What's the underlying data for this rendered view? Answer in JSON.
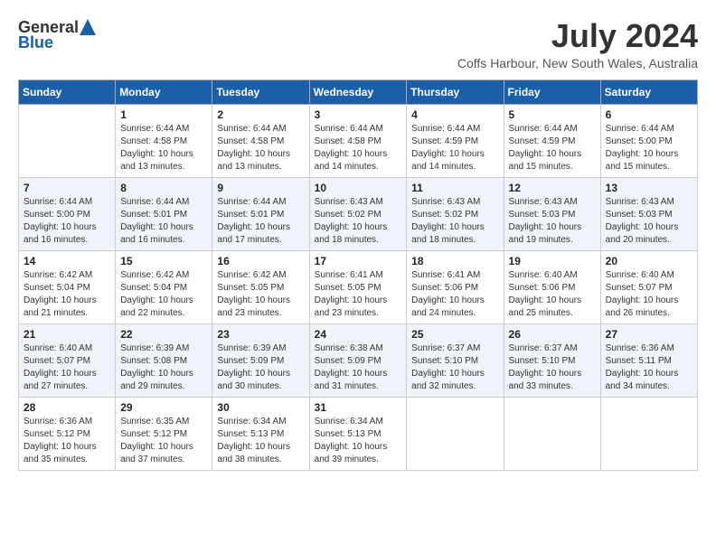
{
  "header": {
    "logo_general": "General",
    "logo_blue": "Blue",
    "month_year": "July 2024",
    "location": "Coffs Harbour, New South Wales, Australia"
  },
  "days_of_week": [
    "Sunday",
    "Monday",
    "Tuesday",
    "Wednesday",
    "Thursday",
    "Friday",
    "Saturday"
  ],
  "weeks": [
    [
      {
        "day": "",
        "sunrise": "",
        "sunset": "",
        "daylight": ""
      },
      {
        "day": "1",
        "sunrise": "Sunrise: 6:44 AM",
        "sunset": "Sunset: 4:58 PM",
        "daylight": "Daylight: 10 hours and 13 minutes."
      },
      {
        "day": "2",
        "sunrise": "Sunrise: 6:44 AM",
        "sunset": "Sunset: 4:58 PM",
        "daylight": "Daylight: 10 hours and 13 minutes."
      },
      {
        "day": "3",
        "sunrise": "Sunrise: 6:44 AM",
        "sunset": "Sunset: 4:58 PM",
        "daylight": "Daylight: 10 hours and 14 minutes."
      },
      {
        "day": "4",
        "sunrise": "Sunrise: 6:44 AM",
        "sunset": "Sunset: 4:59 PM",
        "daylight": "Daylight: 10 hours and 14 minutes."
      },
      {
        "day": "5",
        "sunrise": "Sunrise: 6:44 AM",
        "sunset": "Sunset: 4:59 PM",
        "daylight": "Daylight: 10 hours and 15 minutes."
      },
      {
        "day": "6",
        "sunrise": "Sunrise: 6:44 AM",
        "sunset": "Sunset: 5:00 PM",
        "daylight": "Daylight: 10 hours and 15 minutes."
      }
    ],
    [
      {
        "day": "7",
        "sunrise": "Sunrise: 6:44 AM",
        "sunset": "Sunset: 5:00 PM",
        "daylight": "Daylight: 10 hours and 16 minutes."
      },
      {
        "day": "8",
        "sunrise": "Sunrise: 6:44 AM",
        "sunset": "Sunset: 5:01 PM",
        "daylight": "Daylight: 10 hours and 16 minutes."
      },
      {
        "day": "9",
        "sunrise": "Sunrise: 6:44 AM",
        "sunset": "Sunset: 5:01 PM",
        "daylight": "Daylight: 10 hours and 17 minutes."
      },
      {
        "day": "10",
        "sunrise": "Sunrise: 6:43 AM",
        "sunset": "Sunset: 5:02 PM",
        "daylight": "Daylight: 10 hours and 18 minutes."
      },
      {
        "day": "11",
        "sunrise": "Sunrise: 6:43 AM",
        "sunset": "Sunset: 5:02 PM",
        "daylight": "Daylight: 10 hours and 18 minutes."
      },
      {
        "day": "12",
        "sunrise": "Sunrise: 6:43 AM",
        "sunset": "Sunset: 5:03 PM",
        "daylight": "Daylight: 10 hours and 19 minutes."
      },
      {
        "day": "13",
        "sunrise": "Sunrise: 6:43 AM",
        "sunset": "Sunset: 5:03 PM",
        "daylight": "Daylight: 10 hours and 20 minutes."
      }
    ],
    [
      {
        "day": "14",
        "sunrise": "Sunrise: 6:42 AM",
        "sunset": "Sunset: 5:04 PM",
        "daylight": "Daylight: 10 hours and 21 minutes."
      },
      {
        "day": "15",
        "sunrise": "Sunrise: 6:42 AM",
        "sunset": "Sunset: 5:04 PM",
        "daylight": "Daylight: 10 hours and 22 minutes."
      },
      {
        "day": "16",
        "sunrise": "Sunrise: 6:42 AM",
        "sunset": "Sunset: 5:05 PM",
        "daylight": "Daylight: 10 hours and 23 minutes."
      },
      {
        "day": "17",
        "sunrise": "Sunrise: 6:41 AM",
        "sunset": "Sunset: 5:05 PM",
        "daylight": "Daylight: 10 hours and 23 minutes."
      },
      {
        "day": "18",
        "sunrise": "Sunrise: 6:41 AM",
        "sunset": "Sunset: 5:06 PM",
        "daylight": "Daylight: 10 hours and 24 minutes."
      },
      {
        "day": "19",
        "sunrise": "Sunrise: 6:40 AM",
        "sunset": "Sunset: 5:06 PM",
        "daylight": "Daylight: 10 hours and 25 minutes."
      },
      {
        "day": "20",
        "sunrise": "Sunrise: 6:40 AM",
        "sunset": "Sunset: 5:07 PM",
        "daylight": "Daylight: 10 hours and 26 minutes."
      }
    ],
    [
      {
        "day": "21",
        "sunrise": "Sunrise: 6:40 AM",
        "sunset": "Sunset: 5:07 PM",
        "daylight": "Daylight: 10 hours and 27 minutes."
      },
      {
        "day": "22",
        "sunrise": "Sunrise: 6:39 AM",
        "sunset": "Sunset: 5:08 PM",
        "daylight": "Daylight: 10 hours and 29 minutes."
      },
      {
        "day": "23",
        "sunrise": "Sunrise: 6:39 AM",
        "sunset": "Sunset: 5:09 PM",
        "daylight": "Daylight: 10 hours and 30 minutes."
      },
      {
        "day": "24",
        "sunrise": "Sunrise: 6:38 AM",
        "sunset": "Sunset: 5:09 PM",
        "daylight": "Daylight: 10 hours and 31 minutes."
      },
      {
        "day": "25",
        "sunrise": "Sunrise: 6:37 AM",
        "sunset": "Sunset: 5:10 PM",
        "daylight": "Daylight: 10 hours and 32 minutes."
      },
      {
        "day": "26",
        "sunrise": "Sunrise: 6:37 AM",
        "sunset": "Sunset: 5:10 PM",
        "daylight": "Daylight: 10 hours and 33 minutes."
      },
      {
        "day": "27",
        "sunrise": "Sunrise: 6:36 AM",
        "sunset": "Sunset: 5:11 PM",
        "daylight": "Daylight: 10 hours and 34 minutes."
      }
    ],
    [
      {
        "day": "28",
        "sunrise": "Sunrise: 6:36 AM",
        "sunset": "Sunset: 5:12 PM",
        "daylight": "Daylight: 10 hours and 35 minutes."
      },
      {
        "day": "29",
        "sunrise": "Sunrise: 6:35 AM",
        "sunset": "Sunset: 5:12 PM",
        "daylight": "Daylight: 10 hours and 37 minutes."
      },
      {
        "day": "30",
        "sunrise": "Sunrise: 6:34 AM",
        "sunset": "Sunset: 5:13 PM",
        "daylight": "Daylight: 10 hours and 38 minutes."
      },
      {
        "day": "31",
        "sunrise": "Sunrise: 6:34 AM",
        "sunset": "Sunset: 5:13 PM",
        "daylight": "Daylight: 10 hours and 39 minutes."
      },
      {
        "day": "",
        "sunrise": "",
        "sunset": "",
        "daylight": ""
      },
      {
        "day": "",
        "sunrise": "",
        "sunset": "",
        "daylight": ""
      },
      {
        "day": "",
        "sunrise": "",
        "sunset": "",
        "daylight": ""
      }
    ]
  ]
}
